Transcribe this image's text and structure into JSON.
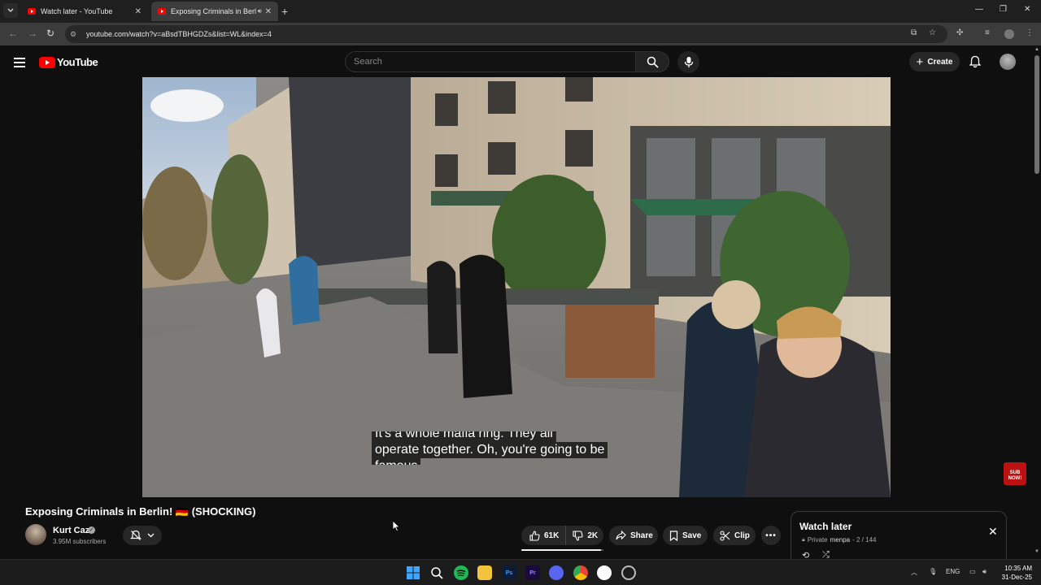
{
  "browser": {
    "tabs": [
      {
        "label": "Watch later - YouTube",
        "active": false
      },
      {
        "label": "Exposing Criminals in Berlin",
        "active": true
      }
    ],
    "url": "youtube.com/watch?v=aBsdTBHGDZs&list=WL&index=4"
  },
  "masthead": {
    "logo_text": "YouTube",
    "search_placeholder": "Search",
    "create_label": "Create"
  },
  "video": {
    "captions": [
      "It's a whole mafia ring. They all",
      "operate together. Oh, you're going to be",
      "famous"
    ],
    "title": "Exposing Criminals in Berlin! 🇩🇪 (SHOCKING)",
    "channel": {
      "name": "Kurt Caz",
      "subscribers": "3.95M subscribers"
    },
    "likes": "61K",
    "dislikes": "2K",
    "like_ratio": 0.97,
    "actions": {
      "share": "Share",
      "save": "Save",
      "clip": "Clip"
    },
    "corner_badge": [
      "SUB",
      "NOW!"
    ]
  },
  "playlist": {
    "title": "Watch later",
    "privacy": "Private",
    "owner": "menpa",
    "position": "2 / 144"
  },
  "taskbar": {
    "apps": [
      "windows",
      "search",
      "spotify",
      "file-explorer",
      "photoshop",
      "premiere",
      "discord",
      "chrome",
      "clock-app",
      "settings"
    ],
    "language": "ENG",
    "time": "10:35 AM",
    "date": "31-Dec-25"
  }
}
